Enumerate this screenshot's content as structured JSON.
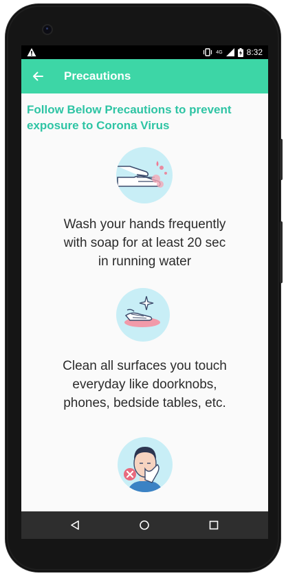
{
  "status_bar": {
    "time": "8:32",
    "network": "4G",
    "icons": [
      "warning-icon",
      "vibrate-icon",
      "signal-icon",
      "battery-charging-icon"
    ]
  },
  "app_bar": {
    "title": "Precautions",
    "back_icon": "arrow-left-icon"
  },
  "headline": "Follow Below Precautions to prevent exposure to Corona Virus",
  "precautions": [
    {
      "icon": "hand-washing-icon",
      "lines": [
        "Wash your hands frequently",
        "with soap for at least 20 sec",
        "in running water"
      ]
    },
    {
      "icon": "surface-cleaning-icon",
      "lines": [
        "Clean all surfaces you touch",
        "everyday like doorknobs,",
        "phones, bedside tables, etc."
      ]
    },
    {
      "icon": "no-face-touch-icon",
      "lines": []
    }
  ],
  "nav_bar": {
    "buttons": [
      "back-triangle-icon",
      "home-circle-icon",
      "recents-square-icon"
    ]
  },
  "colors": {
    "accent": "#3dd6a6",
    "headline": "#2ec4a4",
    "illustration_bg": "#c8eef6",
    "status_bar": "#000000",
    "nav_bar": "#2e2e2e"
  }
}
